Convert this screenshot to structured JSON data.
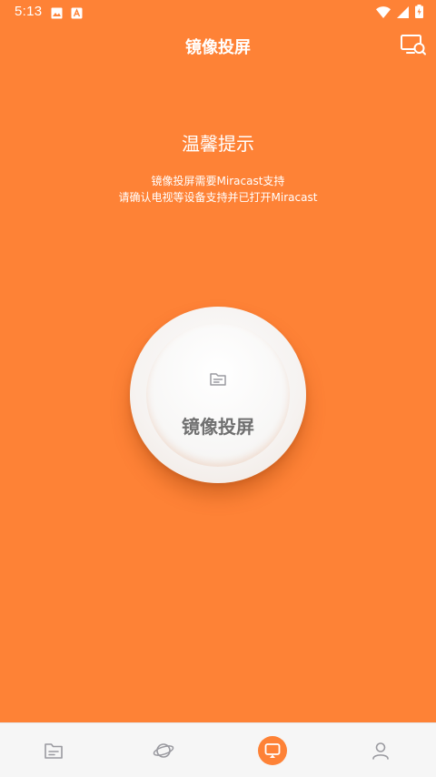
{
  "status_bar": {
    "time": "5:13",
    "icons": [
      "image-icon",
      "app-notification-icon",
      "wifi-icon",
      "signal-icon",
      "battery-icon"
    ]
  },
  "app_bar": {
    "title": "镜像投屏",
    "action_icon": "cast-search-icon"
  },
  "tip": {
    "title": "温馨提示",
    "line1": "镜像投屏需要Miracast支持",
    "line2": "请确认电视等设备支持并已打开Miracast"
  },
  "mirror_button": {
    "label": "镜像投屏",
    "icon": "folder-icon"
  },
  "bottom_nav": {
    "items": [
      {
        "icon": "folder-icon",
        "active": false
      },
      {
        "icon": "planet-icon",
        "active": false
      },
      {
        "icon": "cast-icon",
        "active": true
      },
      {
        "icon": "user-icon",
        "active": false
      }
    ]
  },
  "colors": {
    "primary": "#fe8236",
    "nav_background": "#f6f6f6",
    "nav_icon": "#9a9aa0",
    "button_label": "#707070"
  }
}
